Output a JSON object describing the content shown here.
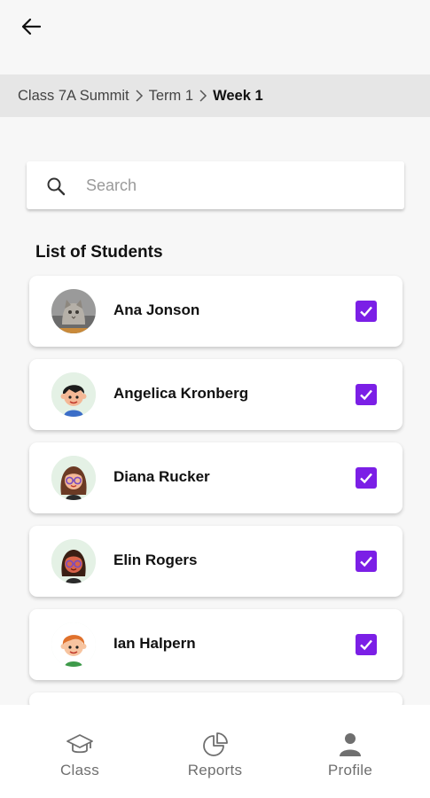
{
  "header": {
    "back_icon": "arrow-left-icon"
  },
  "breadcrumb": {
    "items": [
      "Class 7A Summit",
      "Term 1",
      "Week 1"
    ],
    "separator_icon": "chevron-right-icon"
  },
  "search": {
    "placeholder": "Search",
    "value": "",
    "icon": "search-icon"
  },
  "list": {
    "title": "List of Students",
    "students": [
      {
        "name": "Ana Jonson",
        "avatar": "cat-photo-avatar",
        "checked": true
      },
      {
        "name": "Angelica Kronberg",
        "avatar": "boy-avatar",
        "checked": true
      },
      {
        "name": "Diana Rucker",
        "avatar": "girl-glasses-avatar",
        "checked": true
      },
      {
        "name": "Elin Rogers",
        "avatar": "girl-glasses-dark-avatar",
        "checked": true
      },
      {
        "name": "Ian Halpern",
        "avatar": "redhead-boy-avatar",
        "checked": true
      }
    ]
  },
  "colors": {
    "accent": "#7b1fe6",
    "breadcrumb_bg": "#e6e6e6",
    "background": "#f7f7f7"
  },
  "bottom_nav": {
    "items": [
      {
        "label": "Class",
        "icon": "graduation-cap-icon"
      },
      {
        "label": "Reports",
        "icon": "pie-chart-icon"
      },
      {
        "label": "Profile",
        "icon": "person-icon"
      }
    ]
  }
}
